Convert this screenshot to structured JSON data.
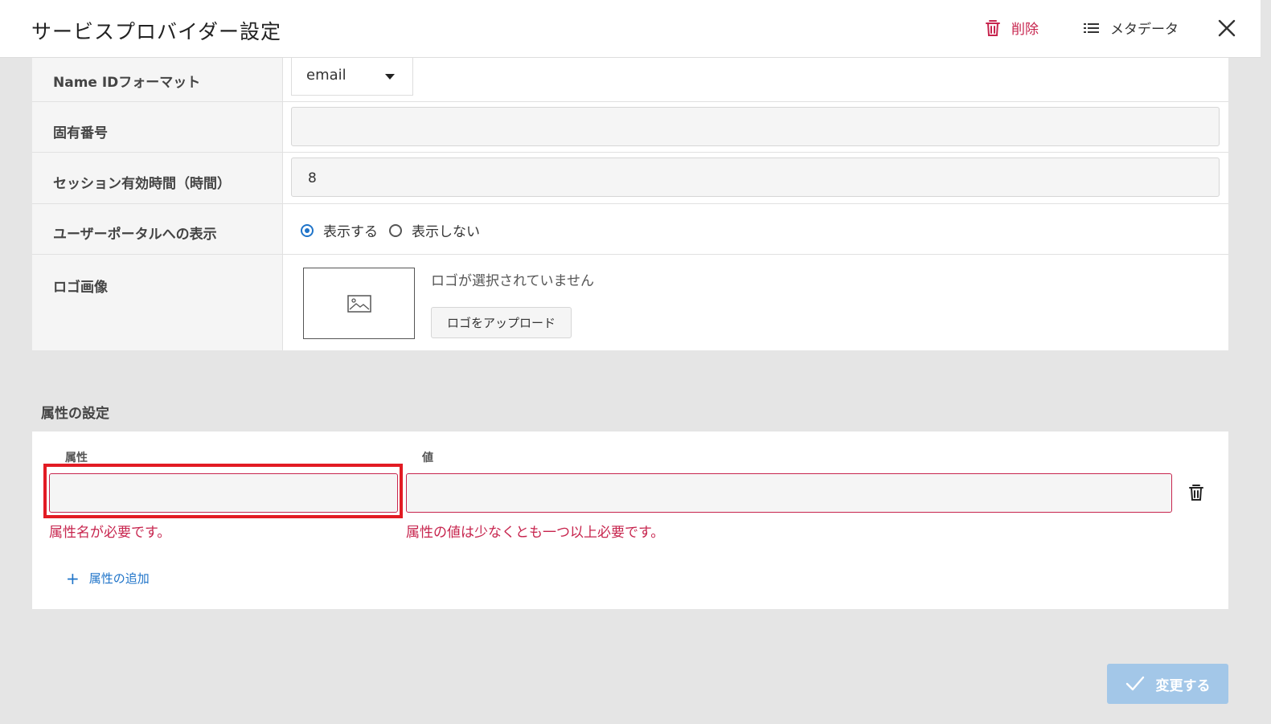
{
  "header": {
    "title": "サービスプロバイダー設定",
    "delete_label": "削除",
    "metadata_label": "メタデータ"
  },
  "form": {
    "name_id_format": {
      "label": "Name IDフォーマット",
      "value": "email"
    },
    "unique_number": {
      "label": "固有番号",
      "value": ""
    },
    "session_duration": {
      "label": "セッション有効時間（時間）",
      "value": "8"
    },
    "portal_display": {
      "label": "ユーザーポータルへの表示",
      "options": [
        {
          "label": "表示する",
          "checked": true
        },
        {
          "label": "表示しない",
          "checked": false
        }
      ]
    },
    "logo": {
      "label": "ロゴ画像",
      "status": "ロゴが選択されていません",
      "upload_label": "ロゴをアップロード"
    }
  },
  "attributes": {
    "section_title": "属性の設定",
    "col_attribute": "属性",
    "col_value": "値",
    "rows": [
      {
        "attribute": "",
        "value": "",
        "attribute_error": "属性名が必要です。",
        "value_error": "属性の値は少なくとも一つ以上必要です。"
      }
    ],
    "add_label": "属性の追加"
  },
  "footer": {
    "submit_label": "変更する"
  },
  "colors": {
    "danger": "#c7254e",
    "accent": "#1f74c9",
    "highlight": "#e21b23",
    "submit_disabled": "#a3c7e8"
  }
}
